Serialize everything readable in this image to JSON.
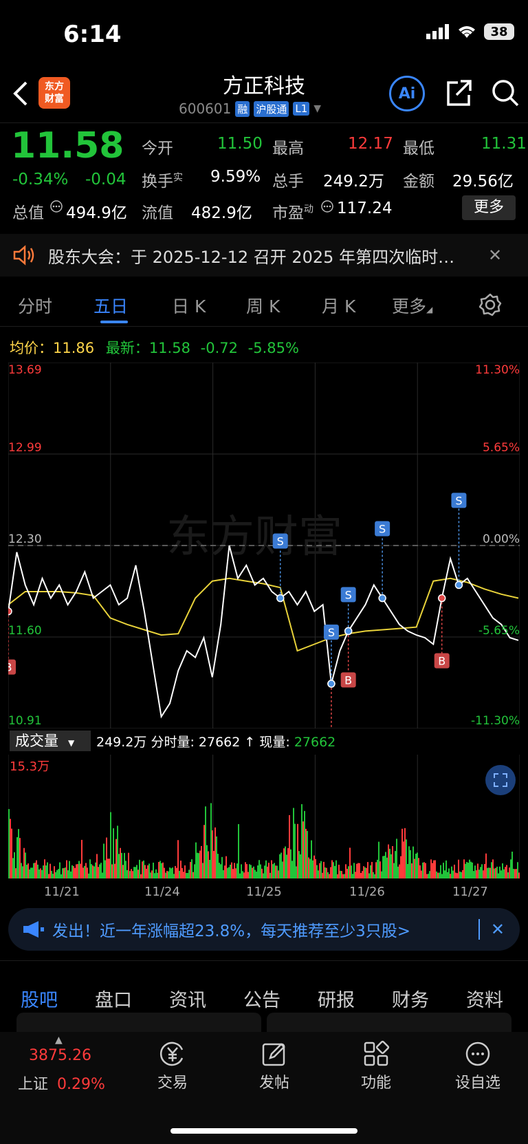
{
  "status_bar": {
    "time": "6:14",
    "battery": "38"
  },
  "header": {
    "logo_line1": "东方",
    "logo_line2": "财富",
    "title": "方正科技",
    "code": "600601",
    "tags": [
      "融",
      "沪股通",
      "L1"
    ],
    "ai_label": "Ai"
  },
  "quote": {
    "price": "11.58",
    "change_pct": "-0.34%",
    "change": "-0.04",
    "open_label": "今开",
    "open": "11.50",
    "high_label": "最高",
    "high": "12.17",
    "low_label": "最低",
    "low": "11.31",
    "turnover_label": "换手",
    "turnover_sup": "实",
    "turnover": "9.59%",
    "volume_label": "总手",
    "volume": "249.2万",
    "amount_label": "金额",
    "amount": "29.56亿",
    "mktcap_label": "总值",
    "mktcap": "494.9亿",
    "float_label": "流值",
    "float": "482.9亿",
    "pe_label": "市盈",
    "pe_sup": "动",
    "pe": "117.24",
    "more_label": "更多"
  },
  "notice": {
    "text": "股东大会：于 2025-12-12 召开 2025 年第四次临时…"
  },
  "period_tabs": [
    "分时",
    "五日",
    "日 K",
    "周 K",
    "月 K",
    "更多"
  ],
  "active_tab": "五日",
  "chart_info": {
    "avg_label": "均价：",
    "avg": "11.86",
    "last_label": "最新：",
    "last": "11.58",
    "chg": "-0.72",
    "chg_pct": "-5.85%"
  },
  "chart_data": {
    "type": "line",
    "x": [
      "11/21",
      "11/24",
      "11/25",
      "11/26",
      "11/27"
    ],
    "ylim": [
      10.91,
      13.69
    ],
    "y_ticks_left": [
      "13.69",
      "12.99",
      "12.30",
      "11.60",
      "10.91"
    ],
    "y_ticks_right": [
      "11.30%",
      "5.65%",
      "0.00%",
      "-5.65%",
      "-11.30%"
    ],
    "prev_close": 12.3,
    "series": [
      {
        "values": [
          11.8,
          12.25,
          12.0,
          11.85,
          12.05,
          11.9,
          12.0,
          11.85,
          11.95,
          12.1,
          11.9,
          11.95,
          12.0,
          11.85,
          11.9,
          12.15,
          11.8,
          11.4,
          11.0,
          11.1,
          11.35,
          11.5,
          11.45,
          11.6,
          11.3,
          11.7,
          12.3,
          12.05,
          12.15,
          12.0,
          12.05,
          11.95,
          11.9,
          11.95,
          11.85,
          11.95,
          11.8,
          11.85,
          11.25,
          11.5,
          11.65,
          11.75,
          11.85,
          12.0,
          11.9,
          11.8,
          11.7,
          11.65,
          11.62,
          11.6,
          11.55,
          11.9,
          12.2,
          12.0,
          12.05,
          11.95,
          11.85,
          11.75,
          11.7,
          11.6,
          11.58
        ]
      },
      {
        "values": [
          11.85,
          11.95,
          11.95,
          11.95,
          11.94,
          11.92,
          11.75,
          11.7,
          11.66,
          11.62,
          11.63,
          11.9,
          12.03,
          12.05,
          12.03,
          12.01,
          11.98,
          11.5,
          11.55,
          11.6,
          11.63,
          11.65,
          11.66,
          11.67,
          11.68,
          12.03,
          12.05,
          12.02,
          11.97,
          11.93,
          11.9
        ]
      }
    ],
    "markers_b": 4,
    "markers_s": 5
  },
  "volume": {
    "label": "成交量",
    "total": "249.2万",
    "tick_label": "分时量:",
    "tick": "27662",
    "arrow": "↑",
    "now_label": "现量:",
    "now": "27662",
    "max": "15.3万"
  },
  "dates": [
    "11/21",
    "11/24",
    "11/25",
    "11/26",
    "11/27"
  ],
  "promo": {
    "text": "发出！近一年涨幅超23.8%，每天推荐至少3只股>"
  },
  "bottom_tabs": [
    "股吧",
    "盘口",
    "资讯",
    "公告",
    "研报",
    "财务",
    "资料"
  ],
  "nav": {
    "index_value": "3875.26",
    "index_name": "上证",
    "index_pct": "0.29%",
    "trade": "交易",
    "post": "发帖",
    "func": "功能",
    "watch": "设自选"
  }
}
